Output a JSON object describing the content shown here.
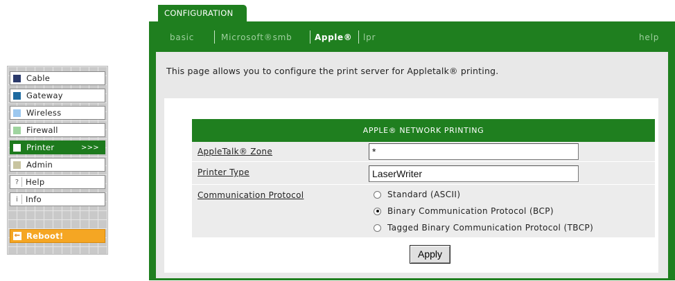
{
  "nav": {
    "items": [
      {
        "label": "Cable",
        "color": "#2b3a6b"
      },
      {
        "label": "Gateway",
        "color": "#1e6aa0"
      },
      {
        "label": "Wireless",
        "color": "#9cc8ef"
      },
      {
        "label": "Firewall",
        "color": "#9fd49f"
      },
      {
        "label": "Printer",
        "color": "#ffffff",
        "arrow": ">>>",
        "active": true
      },
      {
        "label": "Admin",
        "color": "#c8c4a0"
      },
      {
        "label": "Help",
        "glyph": "?"
      },
      {
        "label": "Info",
        "glyph": "i"
      }
    ],
    "reboot": {
      "label": "Reboot!",
      "icon": "logout-icon"
    }
  },
  "tab": {
    "label": "CONFIGURATION"
  },
  "subnav": {
    "items": [
      "basic",
      "Microsoft®smb",
      "Apple®",
      "lpr"
    ],
    "current": "Apple®",
    "help": "help"
  },
  "intro": "This page allows you to configure the print server for Appletalk® printing.",
  "section": {
    "title": "APPLE® NETWORK PRINTING",
    "zone": {
      "label": "AppleTalk® Zone",
      "value": "*"
    },
    "printer_type": {
      "label": "Printer Type",
      "value": "LaserWriter"
    },
    "protocol": {
      "label": "Communication Protocol",
      "options": [
        {
          "label": "Standard (ASCII)",
          "selected": false
        },
        {
          "label": "Binary Communication Protocol (BCP)",
          "selected": true
        },
        {
          "label": "Tagged Binary Communication Protocol (TBCP)",
          "selected": false
        }
      ]
    },
    "apply_label": "Apply"
  }
}
